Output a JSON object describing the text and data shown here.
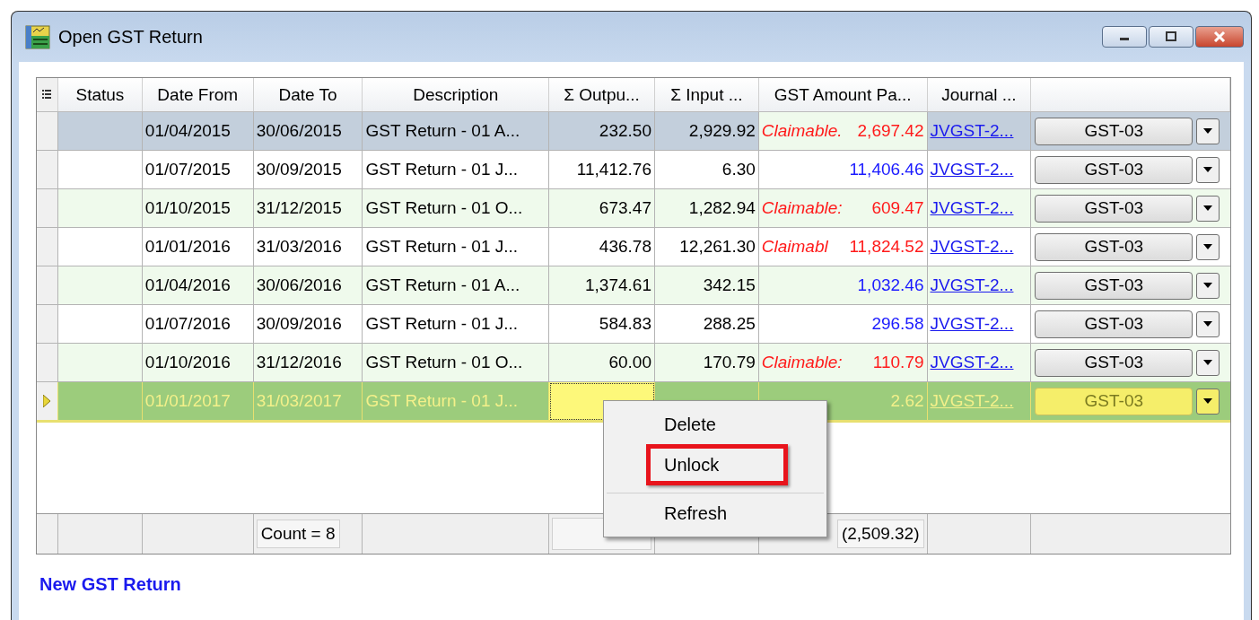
{
  "window": {
    "title": "Open GST Return"
  },
  "columns": [
    "Status",
    "Date From",
    "Date To",
    "Description",
    "Σ Outpu...",
    "Σ Input ...",
    "GST Amount Pa...",
    "Journal ..."
  ],
  "rows": [
    {
      "selected": true,
      "current": false,
      "date_from": "01/04/2015",
      "date_to": "30/06/2015",
      "description": "GST Return - 01 A...",
      "output": "232.50",
      "input": "2,929.92",
      "color": "#ff1a1a",
      "gst_label": "Claimable.",
      "gst_amount": "2,697.42",
      "journal": "JVGST-2...",
      "form": "GST-03"
    },
    {
      "selected": false,
      "current": false,
      "date_from": "01/07/2015",
      "date_to": "30/09/2015",
      "description": "GST Return - 01 J...",
      "output": "11,412.76",
      "input": "6.30",
      "color": "#1a1aff",
      "gst_amount": "11,406.46",
      "journal": "JVGST-2...",
      "form": "GST-03"
    },
    {
      "selected": false,
      "current": false,
      "date_from": "01/10/2015",
      "date_to": "31/12/2015",
      "description": "GST Return - 01 O...",
      "output": "673.47",
      "input": "1,282.94",
      "color": "#ff1a1a",
      "gst_label": "Claimable:",
      "gst_amount": "609.47",
      "journal": "JVGST-2...",
      "form": "GST-03"
    },
    {
      "selected": false,
      "current": false,
      "date_from": "01/01/2016",
      "date_to": "31/03/2016",
      "description": "GST Return - 01 J...",
      "output": "436.78",
      "input": "12,261.30",
      "color": "#ff1a1a",
      "gst_label": "Claimabl",
      "gst_amount": "11,824.52",
      "journal": "JVGST-2...",
      "form": "GST-03"
    },
    {
      "selected": false,
      "current": false,
      "date_from": "01/04/2016",
      "date_to": "30/06/2016",
      "description": "GST Return - 01 A...",
      "output": "1,374.61",
      "input": "342.15",
      "color": "#1a1aff",
      "gst_amount": "1,032.46",
      "journal": "JVGST-2...",
      "form": "GST-03"
    },
    {
      "selected": false,
      "current": false,
      "date_from": "01/07/2016",
      "date_to": "30/09/2016",
      "description": "GST Return - 01 J...",
      "output": "584.83",
      "input": "288.25",
      "color": "#1a1aff",
      "gst_amount": "296.58",
      "journal": "JVGST-2...",
      "form": "GST-03"
    },
    {
      "selected": false,
      "current": false,
      "date_from": "01/10/2016",
      "date_to": "31/12/2016",
      "description": "GST Return - 01 O...",
      "output": "60.00",
      "input": "170.79",
      "color": "#ff1a1a",
      "gst_label": "Claimable:",
      "gst_amount": "110.79",
      "journal": "JVGST-2...",
      "form": "GST-03"
    },
    {
      "selected": true,
      "current": true,
      "date_from": "01/01/2017",
      "date_to": "31/03/2017",
      "description": "GST Return - 01 J...",
      "gst_amount": "2.62",
      "journal": "JVGST-2...",
      "form": "GST-03"
    }
  ],
  "footer": {
    "count": "Count = 8",
    "gst_total": "(2,509.32)"
  },
  "context_menu": [
    {
      "label": "Delete",
      "highlighted": false,
      "separator": false
    },
    {
      "label": "Unlock",
      "highlighted": true,
      "separator": false
    },
    {
      "label": "Refresh",
      "highlighted": false,
      "separator": true
    }
  ],
  "link": "New GST Return"
}
